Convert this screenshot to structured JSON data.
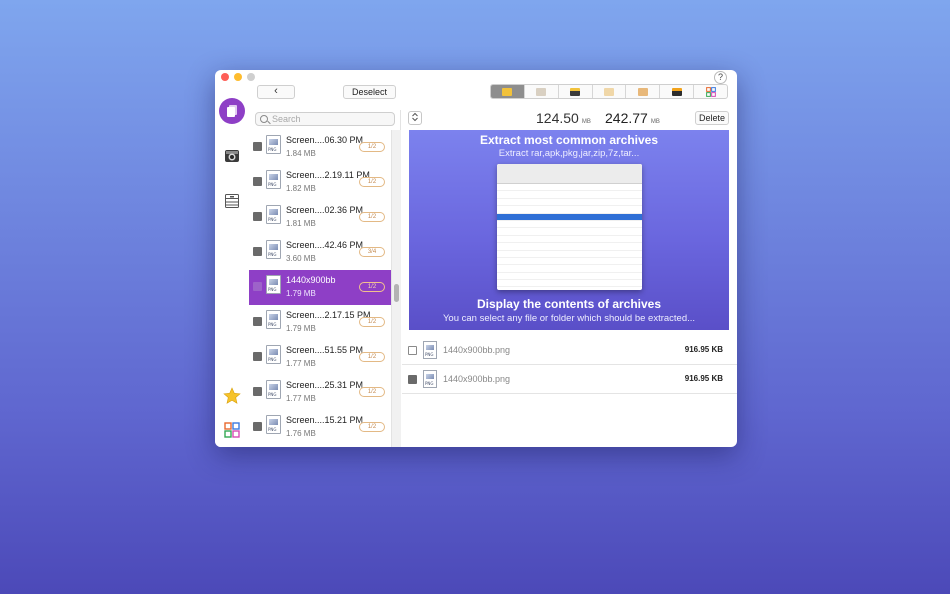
{
  "window": {
    "help_label": "?"
  },
  "toolbar": {
    "back_label": "‹",
    "deselect_label": "Deselect"
  },
  "sidebar": {
    "items": [
      {
        "icon": "photos-icon",
        "active": true
      },
      {
        "icon": "camera-icon",
        "active": false
      },
      {
        "icon": "archive-drawer-icon",
        "active": false
      },
      {
        "icon": "star-icon",
        "active": false
      },
      {
        "icon": "apps-grid-icon",
        "active": false
      }
    ]
  },
  "search": {
    "placeholder": "Search"
  },
  "files": [
    {
      "name": "Screen....06.30 PM",
      "size": "1.84 MB",
      "badge": "1/2",
      "selected": false
    },
    {
      "name": "Screen....2.19.11 PM",
      "size": "1.82 MB",
      "badge": "1/2",
      "selected": false
    },
    {
      "name": "Screen....02.36 PM",
      "size": "1.81 MB",
      "badge": "1/2",
      "selected": false
    },
    {
      "name": "Screen....42.46 PM",
      "size": "3.60 MB",
      "badge": "3/4",
      "selected": false
    },
    {
      "name": "1440x900bb",
      "size": "1.79 MB",
      "badge": "1/2",
      "selected": true
    },
    {
      "name": "Screen....2.17.15 PM",
      "size": "1.79 MB",
      "badge": "1/2",
      "selected": false
    },
    {
      "name": "Screen....51.55 PM",
      "size": "1.77 MB",
      "badge": "1/2",
      "selected": false
    },
    {
      "name": "Screen....25.31 PM",
      "size": "1.77 MB",
      "badge": "1/2",
      "selected": false
    },
    {
      "name": "Screen....15.21 PM",
      "size": "1.76 MB",
      "badge": "1/2",
      "selected": false
    }
  ],
  "summary": {
    "size_selected": "124.50",
    "size_selected_unit": "MB",
    "size_total": "242.77",
    "size_total_unit": "MB",
    "delete_label": "Delete"
  },
  "preview": {
    "title_top": "Extract most common archives",
    "subtitle_top": "Extract rar,apk,pkg,jar,zip,7z,tar...",
    "title_bottom": "Display the contents of archives",
    "subtitle_bottom": "You can select any file or folder which should be extracted..."
  },
  "duplicates": [
    {
      "name": "1440x900bb.png",
      "size": "916.95 KB",
      "checked": false
    },
    {
      "name": "1440x900bb.png",
      "size": "916.95 KB",
      "checked": true
    }
  ],
  "colors": {
    "accent": "#8e3fc6",
    "badge_border": "#e3b985"
  }
}
